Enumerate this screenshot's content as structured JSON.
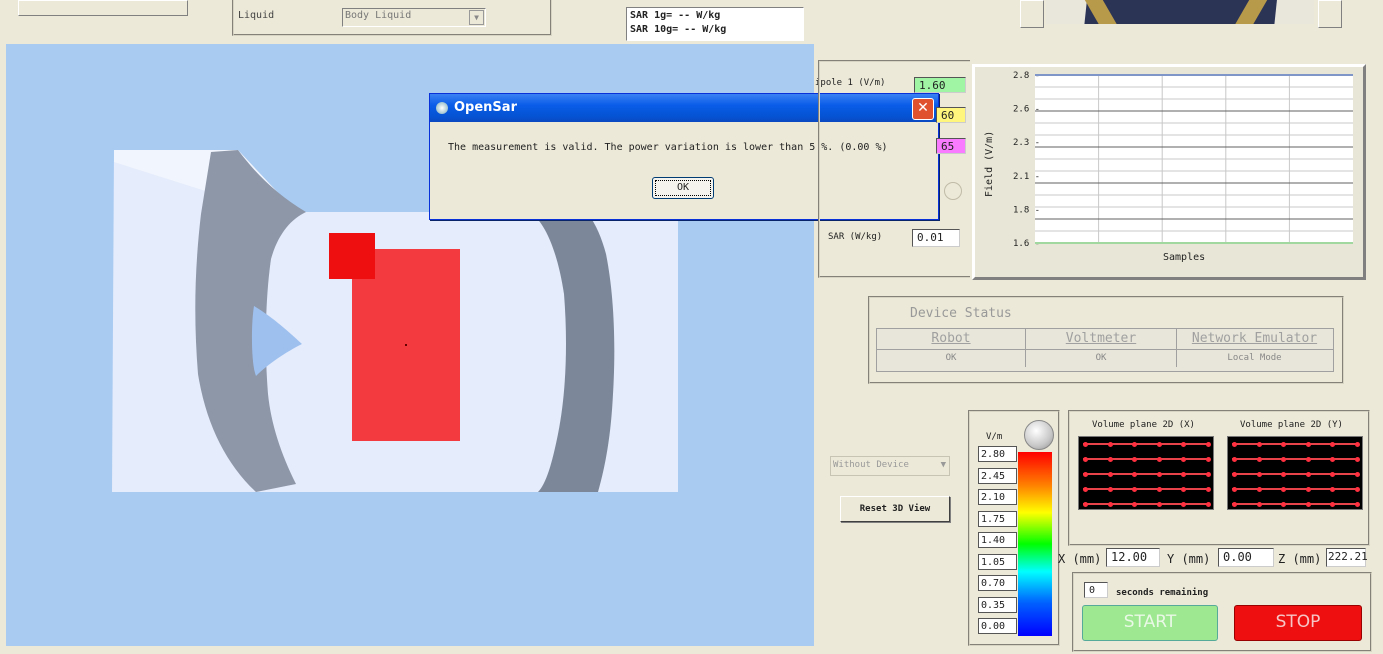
{
  "top": {
    "liquid_label": "Liquid",
    "liquid_value": "Body Liquid",
    "sar_1g": "SAR 1g= -- W/kg",
    "sar_10g": "SAR 10g= -- W/kg"
  },
  "dialog": {
    "title": "OpenSar",
    "message": "The measurement is valid. The power variation is lower than 5 %. (0.00 %)",
    "ok_label": "OK",
    "close_glyph": "✕"
  },
  "probe": {
    "dipole_label": "ipole 1 (V/m)",
    "dipole_value": "1.60",
    "value2": "60",
    "value3": "65",
    "sar_label": "SAR (W/kg)",
    "sar_value": "0.01"
  },
  "chart_data": {
    "type": "line",
    "ylabel": "Field (V/m)",
    "xlabel": "Samples",
    "y_ticks": [
      "2.8",
      "2.6",
      "2.3",
      "2.1",
      "1.8",
      "1.6"
    ],
    "ylim": [
      1.6,
      2.8
    ],
    "series": [
      {
        "color": "#7e97c8",
        "values": [
          2.8,
          2.8
        ]
      },
      {
        "color": "#a0d8a0",
        "values": [
          1.6,
          1.6
        ]
      }
    ],
    "grid": true
  },
  "device_status": {
    "title": "Device Status",
    "headers": [
      "Robot",
      "Voltmeter",
      "Network Emulator"
    ],
    "values": [
      "OK",
      "OK",
      "Local Mode"
    ]
  },
  "controls": {
    "device_select": "Without Device",
    "reset_button": "Reset 3D View"
  },
  "colorbar": {
    "unit": "V/m",
    "labels": [
      "2.80",
      "2.45",
      "2.10",
      "1.75",
      "1.40",
      "1.05",
      "0.70",
      "0.35",
      "0.00"
    ]
  },
  "volume": {
    "x_title": "Volume plane 2D (X)",
    "y_title": "Volume plane 2D (Y)"
  },
  "position": {
    "x_label": "X (mm)",
    "x_value": "12.00",
    "y_label": "Y (mm)",
    "y_value": "0.00",
    "z_label": "Z (mm)",
    "z_value": "222.21"
  },
  "timer": {
    "value": "0",
    "label": "seconds remaining"
  },
  "buttons": {
    "start": "START",
    "stop": "STOP"
  }
}
